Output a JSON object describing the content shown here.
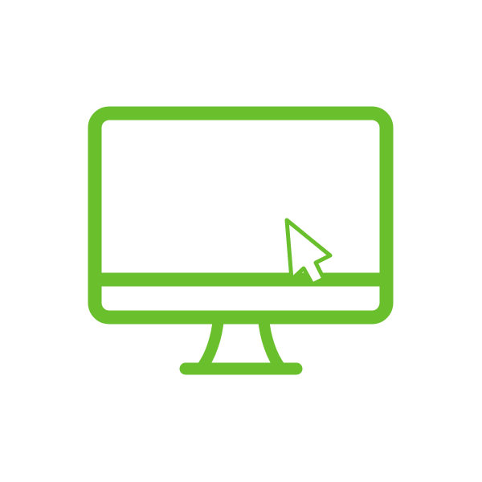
{
  "icon": {
    "name": "desktop-computer-with-cursor-icon",
    "parts": [
      "monitor-icon",
      "cursor-arrow-icon",
      "monitor-stand-icon"
    ]
  },
  "colors": {
    "stroke": "#6ABF2D",
    "background": "#FFFFFF"
  }
}
